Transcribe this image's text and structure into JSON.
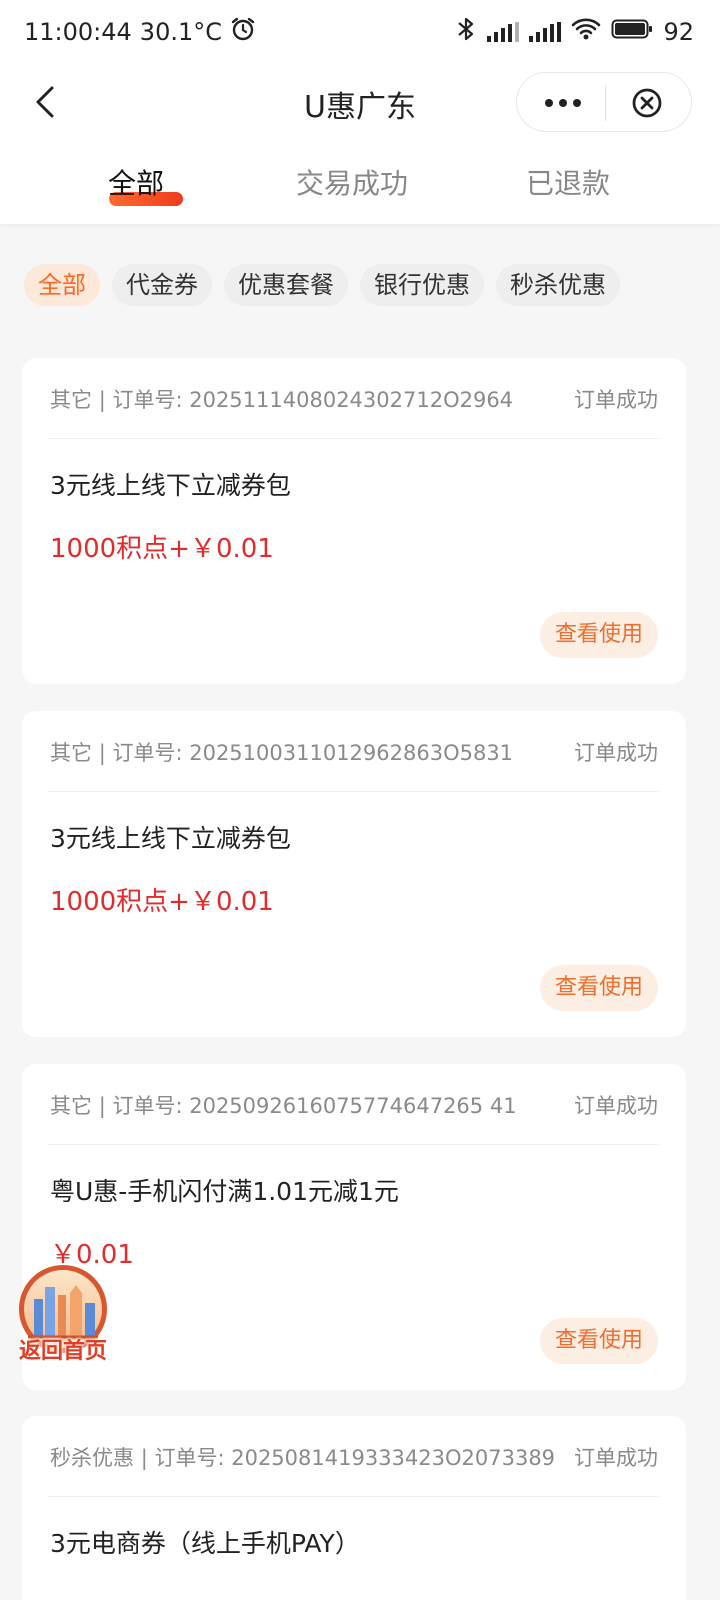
{
  "status_bar": {
    "time": "11:00:44",
    "temperature": "30.1°C",
    "battery": "92"
  },
  "nav": {
    "title": "U惠广东"
  },
  "tabs": [
    "全部",
    "交易成功",
    "已退款"
  ],
  "active_tab": "全部",
  "chips": [
    "全部",
    "代金券",
    "优惠套餐",
    "银行优惠",
    "秒杀优惠"
  ],
  "orders": [
    {
      "category": "其它",
      "order_label": "订单号:",
      "order_no": "2025111408024302712O2964",
      "status": "订单成功",
      "name": "3元线上线下立减券包",
      "price": "1000积点+￥0.01",
      "button": "查看使用"
    },
    {
      "category": "其它",
      "order_label": "订单号:",
      "order_no": "2025100311012962863O5831",
      "status": "订单成功",
      "name": "3元线上线下立减券包",
      "price": "1000积点+￥0.01",
      "button": "查看使用"
    },
    {
      "category": "其它",
      "order_label": "订单号:",
      "order_no": "2025092616075774647265 41",
      "status": "订单成功",
      "name": "粤U惠-手机闪付满1.01元减1元",
      "price": "￥0.01",
      "button": "查看使用"
    },
    {
      "category": "秒杀优惠",
      "order_label": "订单号:",
      "order_no": "2025081419333423O2073389",
      "status": "订单成功",
      "name": "3元电商券（线上手机PAY）",
      "price": "",
      "button": ""
    }
  ],
  "float_button": {
    "label": "返回首页"
  },
  "colors": {
    "accent": "#ff6a22",
    "price": "#e12c2c",
    "tab_underline": "#f03b1e"
  }
}
